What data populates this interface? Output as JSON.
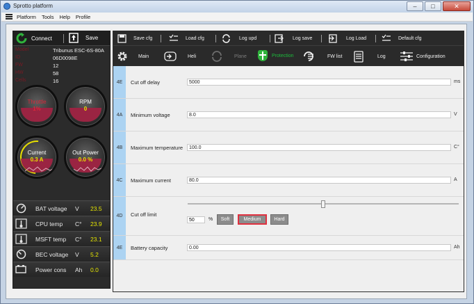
{
  "window": {
    "title": "Sprotto platform",
    "buttons": {
      "minimize": "–",
      "maximize": "□",
      "close": "✕"
    }
  },
  "menu": {
    "items": [
      "Platform",
      "Tools",
      "Help",
      "Profile"
    ]
  },
  "left": {
    "connect_label": "Connect",
    "save_label": "Save",
    "info_rows": [
      {
        "label": "Model",
        "value": "Tribunus ESC-6S-80A"
      },
      {
        "label": "ID",
        "value": "06D0098E"
      },
      {
        "label": "FW",
        "value": "12"
      },
      {
        "label": "HW",
        "value": "58"
      },
      {
        "label": "Cells",
        "value": "16"
      }
    ],
    "gauges": [
      {
        "name": "Throttle",
        "value": "1%",
        "name_color": "#d9283a",
        "value_color": "#d9283a"
      },
      {
        "name": "RPM",
        "value": "0",
        "name_color": "#ffffff",
        "value_color": "#e5e500"
      },
      {
        "name": "Current",
        "value": "0.3 A",
        "name_color": "#ffffff",
        "value_color": "#e5e500"
      },
      {
        "name": "Out Power",
        "value": "0.0 %",
        "name_color": "#ffffff",
        "value_color": "#e5e500"
      }
    ],
    "measures": [
      {
        "icon": "battery-gauge-icon",
        "name": "BAT voltage",
        "unit": "V",
        "value": "23.5"
      },
      {
        "icon": "thermometer-icon",
        "name": "CPU temp",
        "unit": "C°",
        "value": "23.9"
      },
      {
        "icon": "thermometer-icon",
        "name": "MSFT temp",
        "unit": "C°",
        "value": "23.1"
      },
      {
        "icon": "bec-gauge-icon",
        "name": "BEC voltage",
        "unit": "V",
        "value": "5.2"
      },
      {
        "icon": "battery-icon",
        "name": "Power cons",
        "unit": "Ah",
        "value": "0.0"
      }
    ]
  },
  "toolbar1": [
    {
      "icon": "save-cfg-icon",
      "label": "Save cfg"
    },
    {
      "icon": "load-cfg-icon",
      "label": "Load cfg"
    },
    {
      "icon": "refresh-icon",
      "label": "Log upd"
    },
    {
      "icon": "log-save-icon",
      "label": "Log save"
    },
    {
      "icon": "log-load-icon",
      "label": "Log Load"
    },
    {
      "icon": "default-cfg-icon",
      "label": "Default cfg"
    }
  ],
  "toolbar2": [
    {
      "icon": "gear-icon",
      "label": "Main",
      "state": "normal"
    },
    {
      "icon": "heli-icon",
      "label": "Heli",
      "state": "normal"
    },
    {
      "icon": "plane-icon",
      "label": "Plane",
      "state": "disabled"
    },
    {
      "icon": "shield-icon",
      "label": "Protection",
      "state": "active"
    },
    {
      "icon": "fw-list-icon",
      "label": "FW list",
      "state": "normal"
    },
    {
      "icon": "log-icon",
      "label": "Log",
      "state": "normal"
    },
    {
      "icon": "sliders-icon",
      "label": "Configuration",
      "state": "normal"
    }
  ],
  "params": [
    {
      "code": "4E",
      "name": "Cut off delay",
      "value": "5000",
      "unit": "ms"
    },
    {
      "code": "4A",
      "name": "Minimum voltage",
      "value": "8.0",
      "unit": "V"
    },
    {
      "code": "4B",
      "name": "Maximum temperature",
      "value": "100.0",
      "unit": "C°"
    },
    {
      "code": "4C",
      "name": "Maximum current",
      "value": "80.0",
      "unit": "A"
    },
    {
      "code": "4D",
      "name": "Cut off limit",
      "percent_value": "50",
      "percent_sign": "%",
      "slider_fraction": 0.5,
      "modes": [
        "Soft",
        "Medium",
        "Hard"
      ],
      "selected_mode": "Medium"
    },
    {
      "code": "4E",
      "name": "Battery capacity",
      "value": "0.00",
      "unit": "Ah"
    }
  ]
}
